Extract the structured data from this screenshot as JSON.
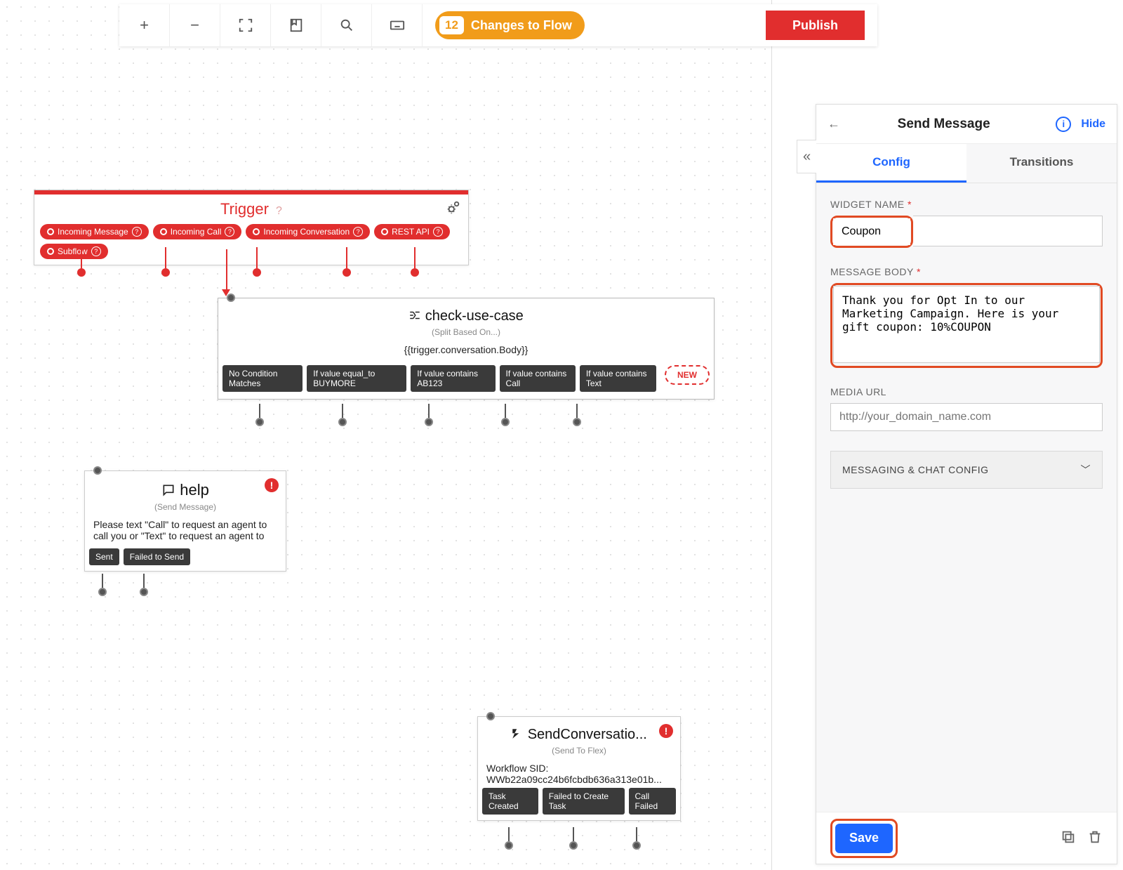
{
  "toolbar": {
    "changes_count": "12",
    "changes_label": "Changes to Flow",
    "publish_label": "Publish"
  },
  "trigger_node": {
    "title": "Trigger",
    "outlets": [
      "Incoming Message",
      "Incoming Call",
      "Incoming Conversation",
      "REST API",
      "Subflow"
    ]
  },
  "split_node": {
    "title": "check-use-case",
    "subtitle": "(Split Based On...)",
    "expression": "{{trigger.conversation.Body}}",
    "chips": [
      "No Condition Matches",
      "If value equal_to BUYMORE",
      "If value contains AB123",
      "If value contains Call",
      "If value contains Text"
    ],
    "new_label": "NEW"
  },
  "help_node": {
    "title": "help",
    "subtitle": "(Send Message)",
    "body": "Please text \"Call\" to request an agent to call you or \"Text\" to request an agent to",
    "chips": [
      "Sent",
      "Failed to Send"
    ]
  },
  "flex_node": {
    "title": "SendConversatio...",
    "subtitle": "(Send To Flex)",
    "body_label": "Workflow SID:",
    "body_value": "WWb22a09cc24b6fcbdb636a313e01b...",
    "chips": [
      "Task Created",
      "Failed to Create Task",
      "Call Failed"
    ]
  },
  "panel": {
    "title": "Send Message",
    "hide_label": "Hide",
    "tabs": {
      "config": "Config",
      "transitions": "Transitions"
    },
    "widget_name_label": "WIDGET NAME",
    "widget_name_value": "Coupon",
    "message_body_label": "MESSAGE BODY",
    "message_body_value": "Thank you for Opt In to our Marketing Campaign. Here is your gift coupon: 10%COUPON",
    "media_url_label": "MEDIA URL",
    "media_url_placeholder": "http://your_domain_name.com",
    "disclosure_label": "MESSAGING & CHAT CONFIG",
    "save_label": "Save"
  }
}
